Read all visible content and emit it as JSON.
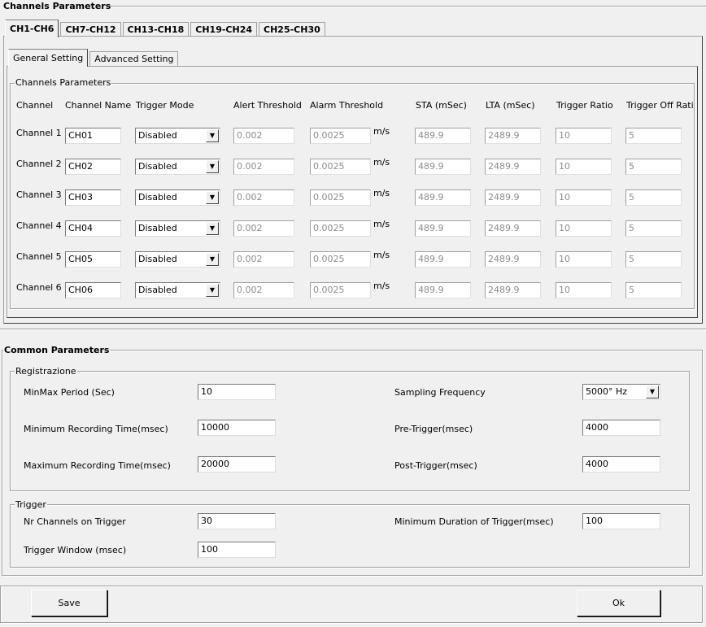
{
  "channels_section": {
    "title": "Channels Parameters"
  },
  "channel_tabs": [
    "CH1-CH6",
    "CH7-CH12",
    "CH13-CH18",
    "CH19-CH24",
    "CH25-CH30"
  ],
  "setting_tabs": [
    "General Setting",
    "Advanced Setting"
  ],
  "channels_group": {
    "title": "Channels Parameters"
  },
  "headers": {
    "channel": "Channel",
    "name": "Channel Name",
    "mode": "Trigger Mode",
    "alert": "Alert Threshold",
    "alarm": "Alarm Threshold",
    "sta": "STA (mSec)",
    "lta": "LTA (mSec)",
    "ratio": "Trigger Ratio",
    "off_ratio": "Trigger Off Ratio"
  },
  "unit": "m/s",
  "rows": [
    {
      "label": "Channel 1",
      "name": "CH01",
      "mode": "Disabled",
      "alert": "0.002",
      "alarm": "0.0025",
      "sta": "489.9",
      "lta": "2489.9",
      "ratio": "10",
      "off": "5"
    },
    {
      "label": "Channel 2",
      "name": "CH02",
      "mode": "Disabled",
      "alert": "0.002",
      "alarm": "0.0025",
      "sta": "489.9",
      "lta": "2489.9",
      "ratio": "10",
      "off": "5"
    },
    {
      "label": "Channel 3",
      "name": "CH03",
      "mode": "Disabled",
      "alert": "0.002",
      "alarm": "0.0025",
      "sta": "489.9",
      "lta": "2489.9",
      "ratio": "10",
      "off": "5"
    },
    {
      "label": "Channel 4",
      "name": "CH04",
      "mode": "Disabled",
      "alert": "0.002",
      "alarm": "0.0025",
      "sta": "489.9",
      "lta": "2489.9",
      "ratio": "10",
      "off": "5"
    },
    {
      "label": "Channel 5",
      "name": "CH05",
      "mode": "Disabled",
      "alert": "0.002",
      "alarm": "0.0025",
      "sta": "489.9",
      "lta": "2489.9",
      "ratio": "10",
      "off": "5"
    },
    {
      "label": "Channel 6",
      "name": "CH06",
      "mode": "Disabled",
      "alert": "0.002",
      "alarm": "0.0025",
      "sta": "489.9",
      "lta": "2489.9",
      "ratio": "10",
      "off": "5"
    }
  ],
  "common": {
    "title": "Common Parameters",
    "registrazione": {
      "title": "Registrazione",
      "minmax_label": "MinMax Period (Sec)",
      "minmax_value": "10",
      "min_rec_label": "Minimum Recording Time(msec)",
      "min_rec_value": "10000",
      "max_rec_label": "Maximum Recording Time(msec)",
      "max_rec_value": "20000",
      "sampling_label": "Sampling Frequency",
      "sampling_value": "5000° Hz",
      "pre_label": "Pre-Trigger(msec)",
      "pre_value": "4000",
      "post_label": "Post-Trigger(msec)",
      "post_value": "4000"
    },
    "trigger": {
      "title": "Trigger",
      "nr_label": "Nr Channels on Trigger",
      "nr_value": "30",
      "window_label": "Trigger Window (msec)",
      "window_value": "100",
      "min_dur_label": "Minimum Duration of Trigger(msec)",
      "min_dur_value": "100"
    }
  },
  "buttons": {
    "save": "Save",
    "ok": "Ok"
  }
}
